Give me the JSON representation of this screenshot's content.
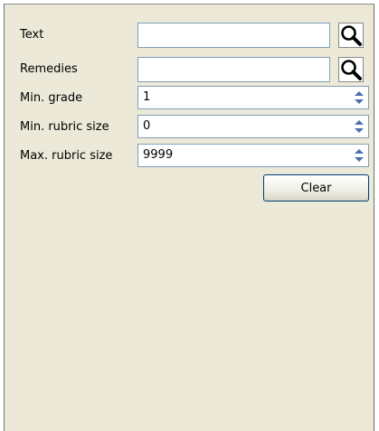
{
  "filters": {
    "text": {
      "label": "Text",
      "value": "",
      "search_icon": "magnifier-icon"
    },
    "remedies": {
      "label": "Remedies",
      "value": "",
      "search_icon": "magnifier-icon"
    },
    "min_grade": {
      "label": "Min. grade",
      "value": "1"
    },
    "min_rubric_size": {
      "label": "Min. rubric size",
      "value": "0"
    },
    "max_rubric_size": {
      "label": "Max. rubric size",
      "value": "9999"
    }
  },
  "actions": {
    "clear_label": "Clear"
  },
  "colors": {
    "panel_bg": "#ece9d8",
    "field_border": "#7f9db9",
    "spinner_arrow": "#4a6fb0"
  }
}
